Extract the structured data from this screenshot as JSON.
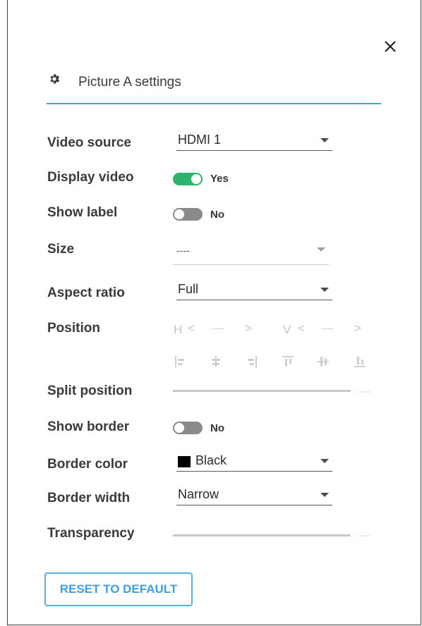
{
  "header": {
    "title": "Picture A settings"
  },
  "fields": {
    "video_source": {
      "label": "Video source",
      "value": "HDMI 1"
    },
    "display_video": {
      "label": "Display video",
      "state": "Yes"
    },
    "show_label": {
      "label": "Show label",
      "state": "No"
    },
    "size": {
      "label": "Size",
      "value": "----"
    },
    "aspect_ratio": {
      "label": "Aspect ratio",
      "value": "Full"
    },
    "position": {
      "label": "Position",
      "h_prefix": "H",
      "h_value": "----",
      "v_prefix": "V",
      "v_value": "----",
      "left_arrow": "<",
      "right_arrow": ">"
    },
    "split_position": {
      "label": "Split position",
      "value": "----"
    },
    "show_border": {
      "label": "Show border",
      "state": "No"
    },
    "border_color": {
      "label": "Border color",
      "value": "Black",
      "swatch": "#000000"
    },
    "border_width": {
      "label": "Border width",
      "value": "Narrow"
    },
    "transparency": {
      "label": "Transparency",
      "value": "----"
    }
  },
  "reset_button": {
    "label": "RESET TO DEFAULT"
  },
  "colors": {
    "accent": "#3ea4e2",
    "toggle_on": "#2db36a",
    "toggle_off": "#8a8a8a"
  },
  "icons": {
    "close": "close-icon",
    "settings": "gear-icon"
  }
}
